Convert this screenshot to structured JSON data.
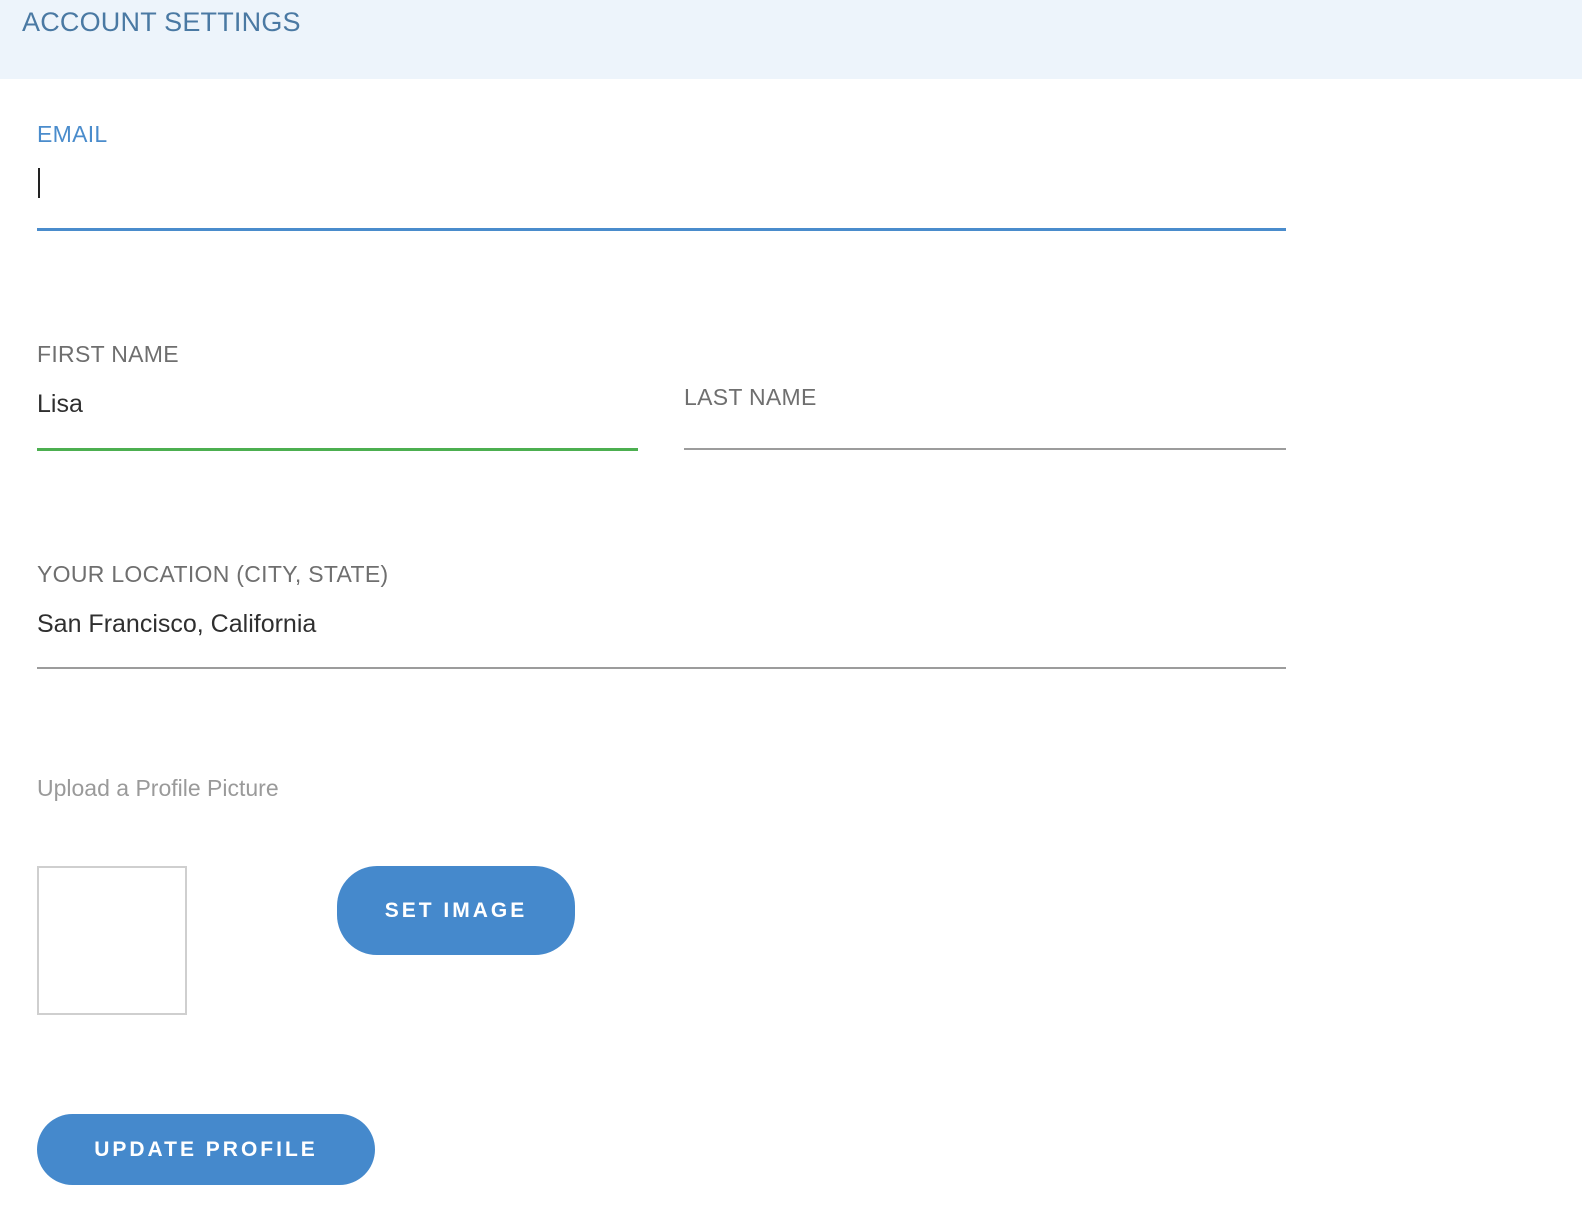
{
  "header": {
    "title": "ACCOUNT SETTINGS"
  },
  "form": {
    "email": {
      "label": "EMAIL",
      "value": "",
      "state": "focused"
    },
    "first_name": {
      "label": "FIRST NAME",
      "value": "Lisa",
      "state": "valid"
    },
    "last_name": {
      "label": "LAST NAME",
      "value": ""
    },
    "location": {
      "label": "YOUR LOCATION (CITY, STATE)",
      "value": "San Francisco, California"
    },
    "upload": {
      "label": "Upload a Profile Picture"
    },
    "set_image_label": "SET IMAGE",
    "update_profile_label": "UPDATE PROFILE"
  },
  "colors": {
    "accent": "#4589cc",
    "header_bg": "#edf4fb",
    "header_text": "#4a79a3",
    "valid": "#4caf50"
  }
}
